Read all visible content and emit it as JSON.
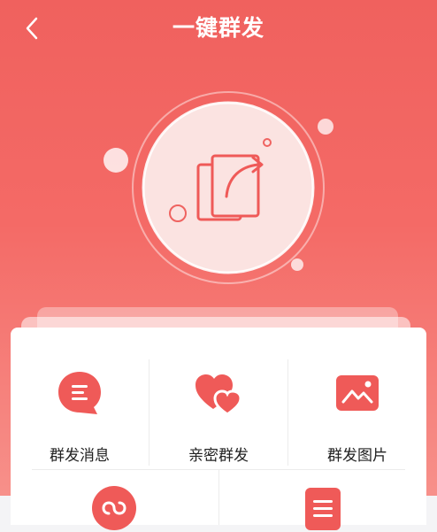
{
  "header": {
    "title": "一键群发",
    "back_icon": "chevron-left-icon"
  },
  "hero": {
    "icon": "share-documents-icon"
  },
  "colors": {
    "brand": "#f0615e",
    "icon_red": "#ef5a58",
    "background": "#f4f4f6"
  },
  "menu": {
    "row1": [
      {
        "label": "群发消息",
        "icon": "chat-bubble-icon"
      },
      {
        "label": "亲密群发",
        "icon": "hearts-icon"
      },
      {
        "label": "群发图片",
        "icon": "image-icon"
      }
    ],
    "row2": [
      {
        "icon": "mini-program-icon"
      },
      {
        "icon": "document-icon"
      }
    ]
  }
}
